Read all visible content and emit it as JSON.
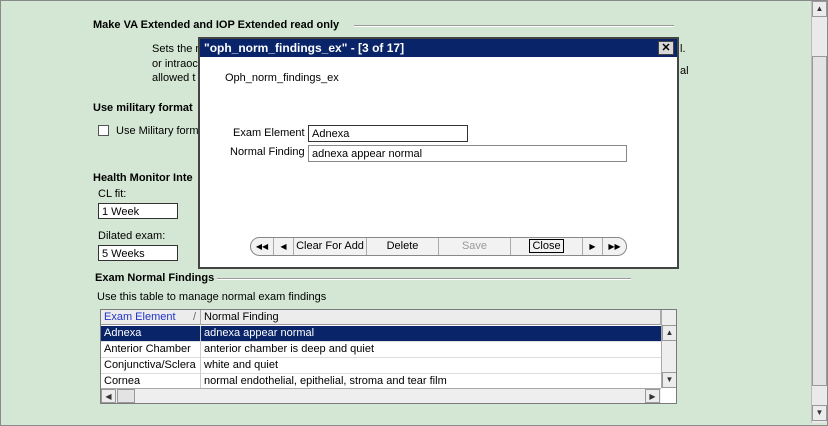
{
  "sections": {
    "va_extended": {
      "title": "Make VA Extended and IOP Extended read only",
      "desc_line1": "Sets the r",
      "desc_line1_tail": "l.",
      "desc_line2": "or intraoc",
      "desc_line2_tail": "al",
      "desc_line3": "allowed t"
    },
    "military": {
      "title": "Use military format",
      "checkbox_label": "Use Military form"
    },
    "health_monitor": {
      "title": "Health Monitor Inte",
      "cl_fit_label": "CL fit:",
      "cl_fit_value": "1 Week",
      "dilated_label": "Dilated exam:",
      "dilated_value": "5 Weeks"
    },
    "exam_normal": {
      "title": "Exam Normal Findings",
      "desc": "Use this table to manage normal exam findings"
    }
  },
  "grid": {
    "columns": [
      "Exam Element",
      "Normal Finding"
    ],
    "sort_indicator": "/",
    "rows": [
      {
        "element": "Adnexa",
        "finding": "adnexa appear normal",
        "selected": true
      },
      {
        "element": "Anterior Chamber",
        "finding": "anterior chamber is deep and quiet",
        "selected": false
      },
      {
        "element": "Conjunctiva/Sclera",
        "finding": "white and quiet",
        "selected": false
      },
      {
        "element": "Cornea",
        "finding": "normal endothelial, epithelial, stroma and tear film",
        "selected": false
      }
    ]
  },
  "dialog": {
    "title": "\"oph_norm_findings_ex\" - [3 of 17]",
    "close_glyph": "✕",
    "table_name": "Oph_norm_findings_ex",
    "exam_element_label": "Exam Element",
    "exam_element_value": "Adnexa",
    "normal_finding_label": "Normal Finding",
    "normal_finding_value": "adnexa appear normal",
    "nav": {
      "first": "◀◀",
      "prev": "◀",
      "clear": "Clear For Add",
      "delete": "Delete",
      "save": "Save",
      "close": "Close",
      "next": "▶",
      "last": "▶▶"
    }
  },
  "scroll_glyphs": {
    "up": "▲",
    "down": "▼",
    "left": "◀",
    "right": "▶"
  },
  "colors": {
    "background": "#d4e7d4",
    "selection": "#0a246a",
    "title_bar": "#0a246a"
  }
}
